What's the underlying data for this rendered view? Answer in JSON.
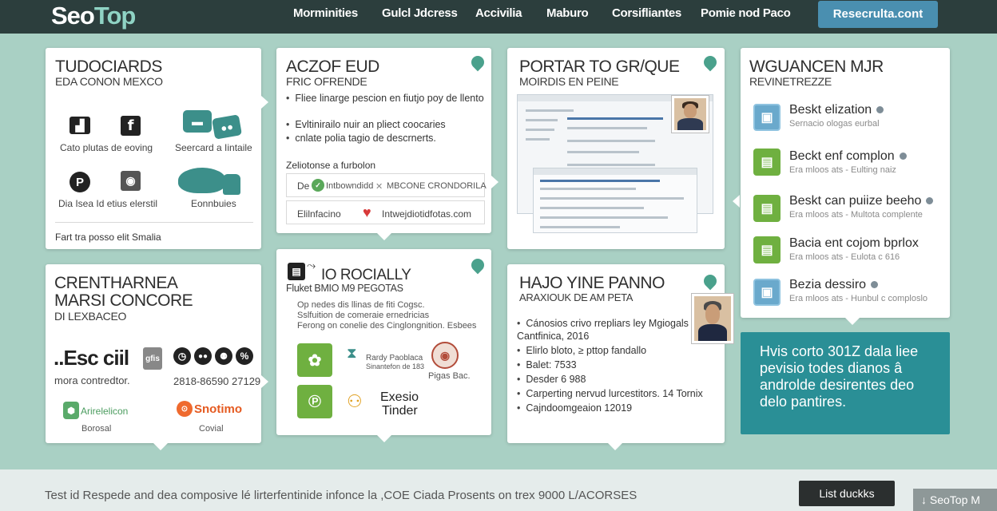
{
  "header": {
    "logo_part1": "Seo",
    "logo_part2": "Top",
    "nav": [
      "Morminities",
      "Gulcl Jdcress",
      "Accivilia",
      "Maburo",
      "Corsifliantes",
      "Pomie nod Paco"
    ],
    "cta": "Resecrulta.cont"
  },
  "card1": {
    "title1": "TUDOCIARDS",
    "title2": "EDA CONON MEXCO",
    "caption1": "Cato plutas de eoving",
    "caption2": "Seercard a Iintaile",
    "caption3": "Dia Isea Id etius elerstil",
    "caption4": "Eonnbuies",
    "footer": "Fart tra posso elit Smalia"
  },
  "card2": {
    "title1": "ACZOF EUD",
    "title2": "FRIC OFRENDE",
    "bullets": [
      "Fliee linarge pescion en fiutjo poy de llento",
      "Evltinirailo nuir an pliect coocaries",
      "cnlate polia tagio de descrnerts."
    ],
    "section_label": "Zeliotonse a furbolon",
    "row1_left": "De",
    "row1_mid": "Intbowndidd",
    "row1_right": "MBCONE CRONDORILA",
    "row2_left": "Elilnfacino",
    "row2_right": "Intwejdiotidfotas.com"
  },
  "card3": {
    "title1": "PORTAR TO GR/QUE",
    "title2": "MOIRDIS EN PEINE"
  },
  "card4": {
    "title1": "WGUANCEN MJR",
    "title2": "REVINETREZZE",
    "items": [
      {
        "title": "Beskt elization",
        "sub": "Sernacio ologas eurbal"
      },
      {
        "title": "Beckt enf complon",
        "sub": "Era mloos ats - Eulting naiz"
      },
      {
        "title": "Beskt can puiize beeho",
        "sub": "Era mloos ats - Multota complente"
      },
      {
        "title": "Bacia ent cojom bprlox",
        "sub": "Era mloos ats - Eulota c 616"
      },
      {
        "title": "Bezia dessiro",
        "sub": "Era mloos ats - Hunbul c comploslo"
      }
    ]
  },
  "card5": {
    "title1": "CRENTHARNEA",
    "title2": "MARSI CONCORE",
    "title3": "DI LEXBACEO",
    "brand_big": "..Esc ciil",
    "brand_tag": "gfis",
    "caption1": "mora contredtor.",
    "phone": "2818-86590 27129",
    "logo1": "Arirelelicon",
    "logo2": "Snotimo",
    "label1": "Borosal",
    "label2": "Covial"
  },
  "card6": {
    "title1": "IO ROCIALLY",
    "title2": "Fluket BMIO M9 PEGOTAS",
    "lines": [
      "Op nedes dis llinas de fiti Cogsc.",
      "Sslfuition de comeraie ernedricias",
      "Ferong on conelie des Cinglongnition. Esbees"
    ],
    "app1_name": "Rardy Paoblaca",
    "app1_sub": "Sinantefon de 183",
    "app2_name": "Pigas Bac.",
    "app3_name": "Exesio",
    "app3_sub": "Tinder"
  },
  "card7": {
    "title1": "HAJO YINE PANNO",
    "title2": "ARAXIOUK DE AM PETA",
    "bullets": [
      "Cánosios crivo rrepliars ley Mgiogals Cantfinica, 2016",
      "Elirlo bloto, ≥ pttop fandallo",
      "Balet: 7533",
      "Desder 6 988",
      "Carperting nervud lurcestitors. 14 Tornix",
      "Cajndoomgeaion 12019"
    ]
  },
  "teal_panel": {
    "text": "Hvis corto 301Z dala liee pevisio todes dianos â androlde desirentes deo delo pantires."
  },
  "footer": {
    "text": "Test id Respede and dea composive lé lirterfentinide infonce la ,COE Ciada Prosents on trex 9000 L/ACORSES",
    "button": "List duckks",
    "badge": "SeoTop M"
  },
  "colors": {
    "background": "#a9d0c4",
    "header": "#2c3e3d",
    "accent_blue": "#4a8fb0",
    "accent_teal": "#2a8f96",
    "pin_green": "#4aa18c"
  }
}
